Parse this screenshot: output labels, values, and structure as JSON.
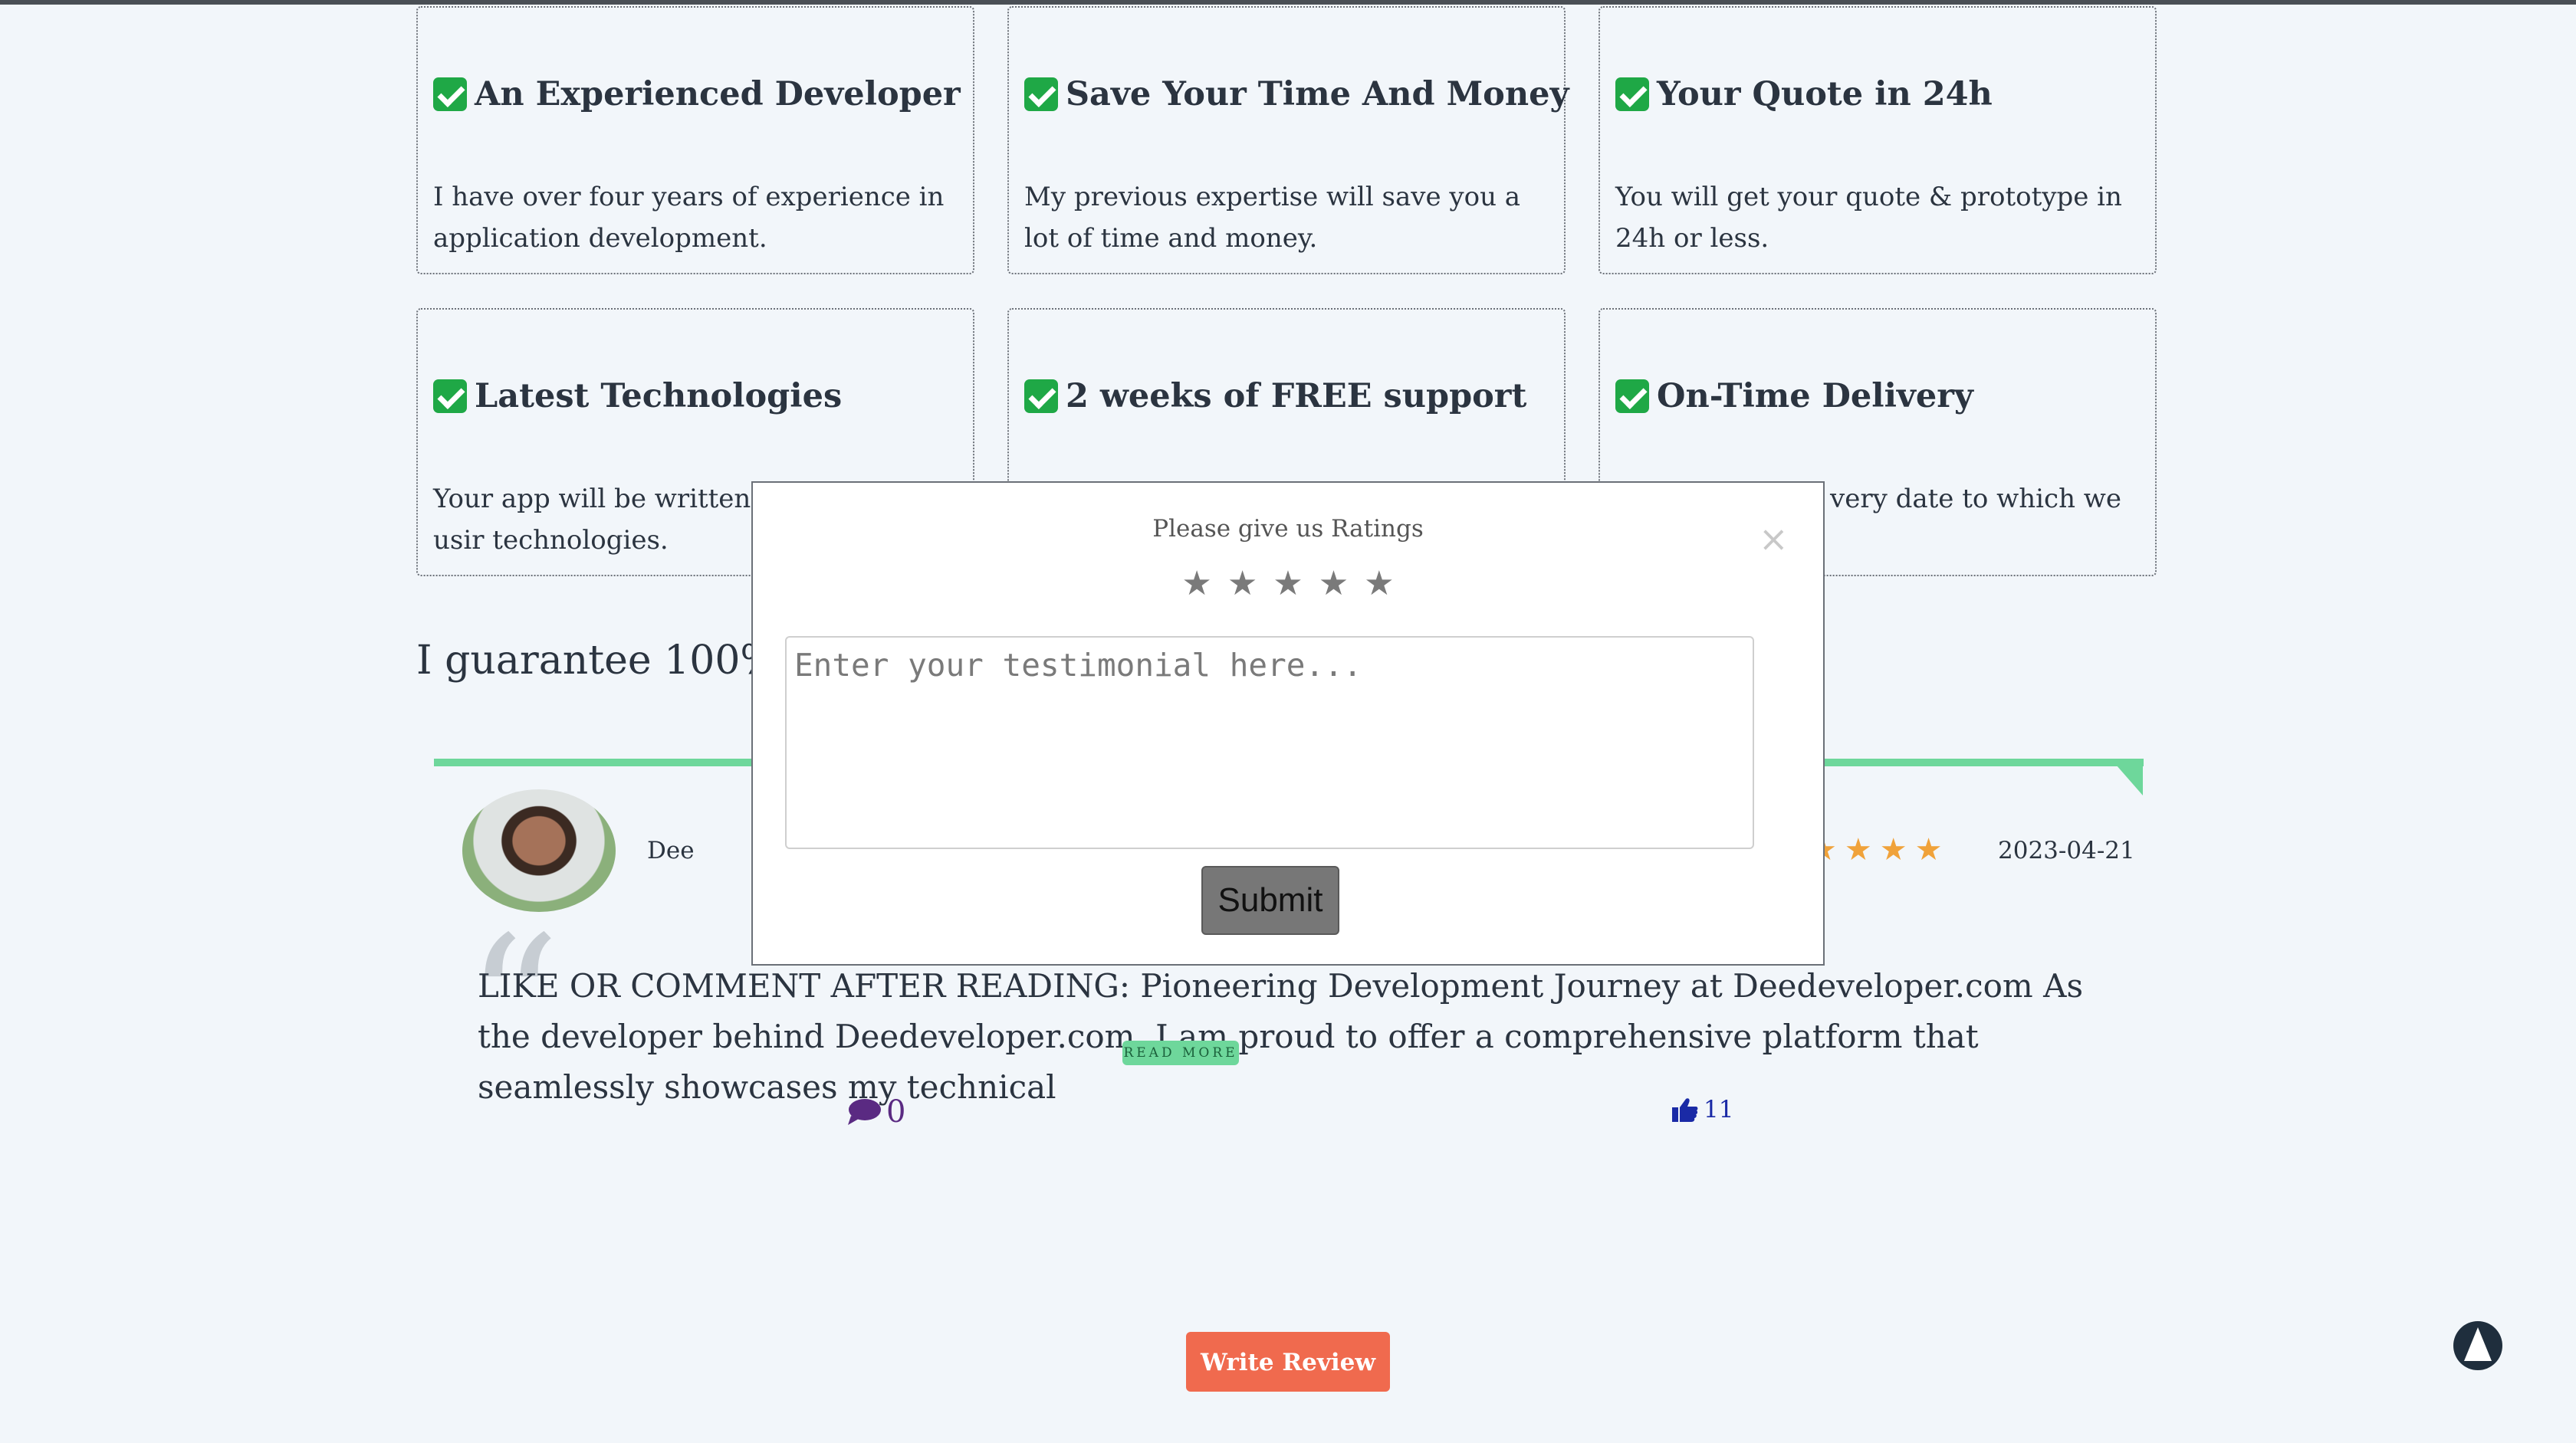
{
  "features": [
    {
      "title": "An Experienced Developer",
      "body": "I have over four years of experience in application development."
    },
    {
      "title": "Save Your Time And Money",
      "body": "My previous expertise will save you a lot of time and money."
    },
    {
      "title": "Your Quote in 24h",
      "body": "You will get your quote & prototype in 24h or less."
    },
    {
      "title": "Latest Technologies",
      "body": "Your app will be written usir technologies."
    },
    {
      "title": "2 weeks of FREE support",
      "body": ""
    },
    {
      "title": "On-Time Delivery",
      "body": "very date to which we"
    }
  ],
  "guarantee_text": "I guarantee 100% s",
  "review": {
    "name": "Dee",
    "stars": "★★★★",
    "date": "2023-04-21",
    "text": "LIKE OR COMMENT AFTER READING: Pioneering Development Journey at Deedeveloper.com As the developer behind Deedeveloper.com, I am proud to offer a comprehensive platform that seamlessly showcases my technical",
    "read_more": "READ MORE",
    "comments": "0",
    "likes": "11"
  },
  "modal": {
    "title": "Please give us Ratings",
    "close": "×",
    "star": "★",
    "placeholder": "Enter your testimonial here...",
    "submit": "Submit"
  },
  "write_review": "Write Review",
  "colors": {
    "accent_green": "#6ed79b",
    "button_orange": "#f06a4e",
    "star_orange": "#f0a23a"
  },
  "icons": [
    "check-icon",
    "comment-icon",
    "thumbs-up-icon",
    "close-icon",
    "arrow-up-icon",
    "star-icon",
    "quote-icon"
  ]
}
